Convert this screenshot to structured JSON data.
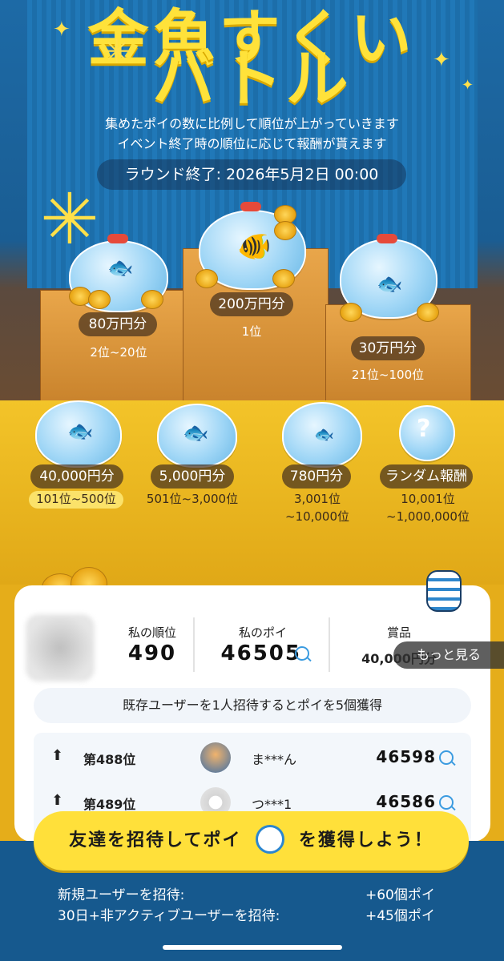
{
  "header": {
    "title_top": "金魚すくい",
    "title_main": "バトル",
    "description_line1": "集めたポイの数に比例して順位が上がっていきます",
    "description_line2": "イベント終了時の順位に応じて報酬が貰えます",
    "round_end": "ラウンド終了: 2026年5月2日 00:00"
  },
  "prizes": [
    {
      "amount": "80万円分",
      "rank": "2位~20位"
    },
    {
      "amount": "200万円分",
      "rank": "1位"
    },
    {
      "amount": "30万円分",
      "rank": "21位~100位"
    },
    {
      "amount": "40,000円分",
      "rank": "101位~500位"
    },
    {
      "amount": "5,000円分",
      "rank": "501位~3,000位"
    },
    {
      "amount": "780円分",
      "rank_line1": "3,001位",
      "rank_line2": "~10,000位"
    },
    {
      "amount": "ランダム報酬",
      "rank_line1": "10,001位",
      "rank_line2": "~1,000,000位"
    }
  ],
  "my_stats": {
    "rank_label": "私の順位",
    "rank_value": "490",
    "poi_label": "私のポイ",
    "poi_value": "46505",
    "prize_label": "賞品",
    "prize_value": "40,000円分",
    "more_label": "もっと見る"
  },
  "invite_note": "既存ユーザーを1人招待するとポイを5個獲得",
  "leaderboard": [
    {
      "position": "第488位",
      "name": "ま***ん",
      "score": "46598"
    },
    {
      "position": "第489位",
      "name": "つ***1",
      "score": "46586"
    }
  ],
  "cta": {
    "label_before": "友達を招待してポイ",
    "label_after": "を獲得しよう！"
  },
  "rewards": [
    {
      "label": "新規ユーザーを招待:",
      "value": "+60個ポイ"
    },
    {
      "label": "30日+非アクティブユーザーを招待:",
      "value": "+45個ポイ"
    }
  ],
  "colors": {
    "accent_yellow": "#ffe03a",
    "navy": "#16598e",
    "rank_highlight": "#fbe26a"
  }
}
